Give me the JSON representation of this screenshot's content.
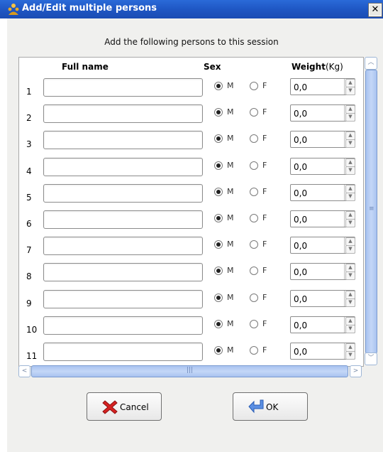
{
  "window": {
    "title": "Add/Edit multiple persons",
    "close_label": "✕"
  },
  "instruction": "Add the following persons to this session",
  "columns": {
    "full_name": "Full name",
    "sex": "Sex",
    "weight": "Weight",
    "weight_unit": "(Kg)"
  },
  "rows": [
    {
      "num": "1",
      "name": "",
      "sex": "M",
      "weight": "0,0"
    },
    {
      "num": "2",
      "name": "",
      "sex": "M",
      "weight": "0,0"
    },
    {
      "num": "3",
      "name": "",
      "sex": "M",
      "weight": "0,0"
    },
    {
      "num": "4",
      "name": "",
      "sex": "M",
      "weight": "0,0"
    },
    {
      "num": "5",
      "name": "",
      "sex": "M",
      "weight": "0,0"
    },
    {
      "num": "6",
      "name": "",
      "sex": "M",
      "weight": "0,0"
    },
    {
      "num": "7",
      "name": "",
      "sex": "M",
      "weight": "0,0"
    },
    {
      "num": "8",
      "name": "",
      "sex": "M",
      "weight": "0,0"
    },
    {
      "num": "9",
      "name": "",
      "sex": "M",
      "weight": "0,0"
    },
    {
      "num": "10",
      "name": "",
      "sex": "M",
      "weight": "0,0"
    },
    {
      "num": "11",
      "name": "",
      "sex": "M",
      "weight": "0,0"
    }
  ],
  "sex_options": {
    "male": "M",
    "female": "F"
  },
  "buttons": {
    "cancel_label": "Cancel",
    "ok_label": "OK"
  },
  "icons": {
    "title": "app-persons-icon",
    "cancel": "red-x-icon",
    "ok": "enter-arrow-icon"
  },
  "colors": {
    "titlebar": "#1f57c4",
    "scroll_thumb": "#b4cbf3"
  }
}
